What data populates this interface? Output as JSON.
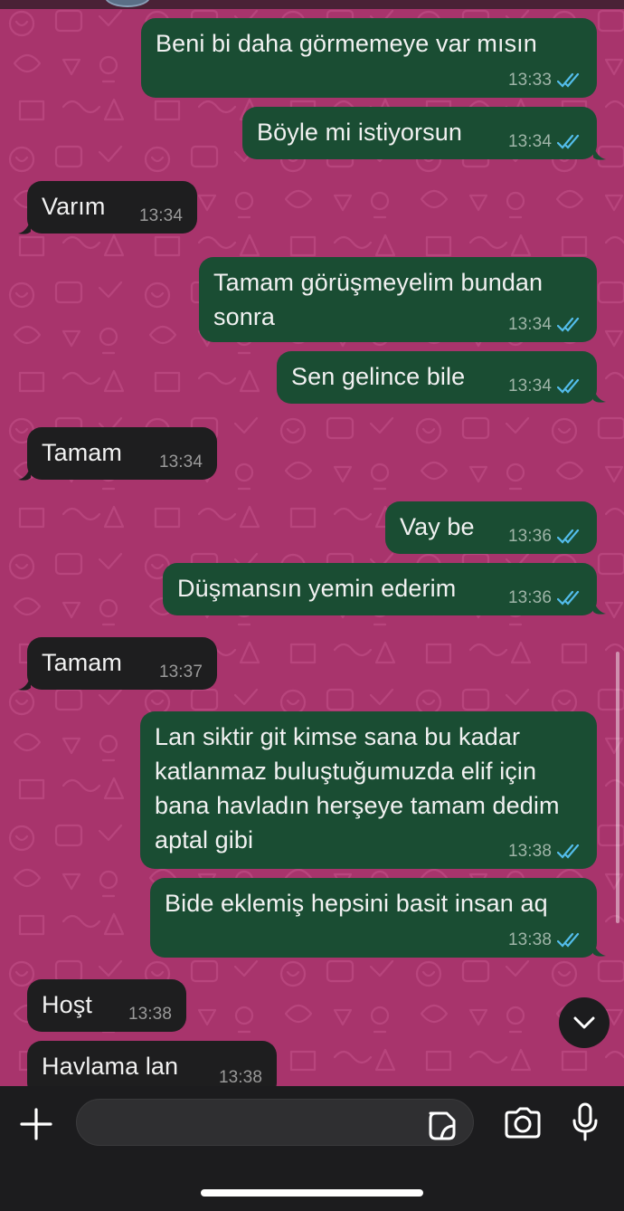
{
  "colors": {
    "wallpaper": "#a8346c",
    "outgoing_bubble": "#1a4d33",
    "incoming_bubble": "#1e1e1f",
    "read_ticks": "#53bdeb",
    "composer_bg": "#1c1c1e"
  },
  "messages": [
    {
      "dir": "out",
      "text": "Beni  bi daha  görmemeye var mısın",
      "time": "13:33",
      "status": "read"
    },
    {
      "dir": "out",
      "text": "Böyle mi istiyorsun",
      "time": "13:34",
      "status": "read"
    },
    {
      "dir": "in",
      "text": "Varım",
      "time": "13:34"
    },
    {
      "dir": "out",
      "text": "Tamam görüşmeyelim bundan sonra",
      "time": "13:34",
      "status": "read"
    },
    {
      "dir": "out",
      "text": "Sen gelince bile",
      "time": "13:34",
      "status": "read"
    },
    {
      "dir": "in",
      "text": "Tamam",
      "time": "13:34"
    },
    {
      "dir": "out",
      "text": "Vay be",
      "time": "13:36",
      "status": "read"
    },
    {
      "dir": "out",
      "text": "Düşmansın yemin ederim",
      "time": "13:36",
      "status": "read"
    },
    {
      "dir": "in",
      "text": "Tamam",
      "time": "13:37"
    },
    {
      "dir": "out",
      "text": "Lan siktir git kimse sana bu kadar katlanmaz buluştuğumuzda elif için bana havladın  herşeye tamam dedim aptal gibi",
      "time": "13:38",
      "status": "read"
    },
    {
      "dir": "out",
      "text": "Bide eklemiş hepsini basit insan aq",
      "time": "13:38",
      "status": "read"
    },
    {
      "dir": "in",
      "text": "Hoşt",
      "time": "13:38"
    },
    {
      "dir": "in",
      "text": "Havlama lan",
      "time": "13:38"
    }
  ],
  "icons": {
    "scroll_down": "chevron-down-icon",
    "attach": "plus-icon",
    "sticker": "sticker-icon",
    "camera": "camera-icon",
    "mic": "microphone-icon",
    "read_receipt": "double-check-icon"
  },
  "composer": {
    "placeholder": "",
    "value": ""
  }
}
